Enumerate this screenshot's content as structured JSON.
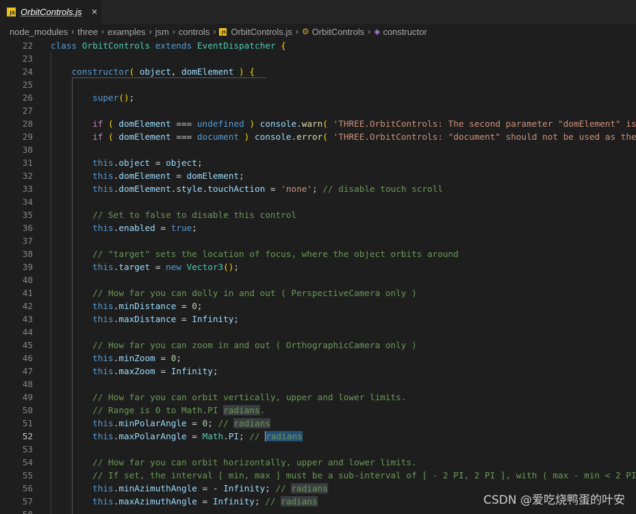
{
  "tab": {
    "title": "OrbitControls.js",
    "icon": "js-file-icon",
    "badge": "JS",
    "close": "×"
  },
  "breadcrumb": {
    "items": [
      "node_modules",
      "three",
      "examples",
      "jsm",
      "controls",
      "OrbitControls.js",
      "OrbitControls",
      "constructor"
    ],
    "separator": "›"
  },
  "editor": {
    "active_line": "52",
    "lines": [
      {
        "n": "22",
        "code": "class OrbitControls extends EventDispatcher {"
      },
      {
        "n": "23",
        "code": ""
      },
      {
        "n": "24",
        "code": "    constructor( object, domElement ) {"
      },
      {
        "n": "25",
        "code": ""
      },
      {
        "n": "26",
        "code": "        super();"
      },
      {
        "n": "27",
        "code": ""
      },
      {
        "n": "28",
        "code": "        if ( domElement === undefined ) console.warn( 'THREE.OrbitControls: The second parameter \"domElement\" is"
      },
      {
        "n": "29",
        "code": "        if ( domElement === document ) console.error( 'THREE.OrbitControls: \"document\" should not be used as the"
      },
      {
        "n": "30",
        "code": ""
      },
      {
        "n": "31",
        "code": "        this.object = object;"
      },
      {
        "n": "32",
        "code": "        this.domElement = domElement;"
      },
      {
        "n": "33",
        "code": "        this.domElement.style.touchAction = 'none'; // disable touch scroll"
      },
      {
        "n": "34",
        "code": ""
      },
      {
        "n": "35",
        "code": "        // Set to false to disable this control"
      },
      {
        "n": "36",
        "code": "        this.enabled = true;"
      },
      {
        "n": "37",
        "code": ""
      },
      {
        "n": "38",
        "code": "        // \"target\" sets the location of focus, where the object orbits around"
      },
      {
        "n": "39",
        "code": "        this.target = new Vector3();"
      },
      {
        "n": "40",
        "code": ""
      },
      {
        "n": "41",
        "code": "        // How far you can dolly in and out ( PerspectiveCamera only )"
      },
      {
        "n": "42",
        "code": "        this.minDistance = 0;"
      },
      {
        "n": "43",
        "code": "        this.maxDistance = Infinity;"
      },
      {
        "n": "44",
        "code": ""
      },
      {
        "n": "45",
        "code": "        // How far you can zoom in and out ( OrthographicCamera only )"
      },
      {
        "n": "46",
        "code": "        this.minZoom = 0;"
      },
      {
        "n": "47",
        "code": "        this.maxZoom = Infinity;"
      },
      {
        "n": "48",
        "code": ""
      },
      {
        "n": "49",
        "code": "        // How far you can orbit vertically, upper and lower limits."
      },
      {
        "n": "50",
        "code": "        // Range is 0 to Math.PI radians."
      },
      {
        "n": "51",
        "code": "        this.minPolarAngle = 0; // radians"
      },
      {
        "n": "52",
        "code": "        this.maxPolarAngle = Math.PI; // radians"
      },
      {
        "n": "53",
        "code": ""
      },
      {
        "n": "54",
        "code": "        // How far you can orbit horizontally, upper and lower limits."
      },
      {
        "n": "55",
        "code": "        // If set, the interval [ min, max ] must be a sub-interval of [ - 2 PI, 2 PI ], with ( max - min < 2 PI"
      },
      {
        "n": "56",
        "code": "        this.minAzimuthAngle = - Infinity; // radians"
      },
      {
        "n": "57",
        "code": "        this.maxAzimuthAngle = Infinity; // radians"
      },
      {
        "n": "58",
        "code": ""
      }
    ]
  },
  "watermark": "CSDN @爱吃烧鸭蛋的叶安"
}
